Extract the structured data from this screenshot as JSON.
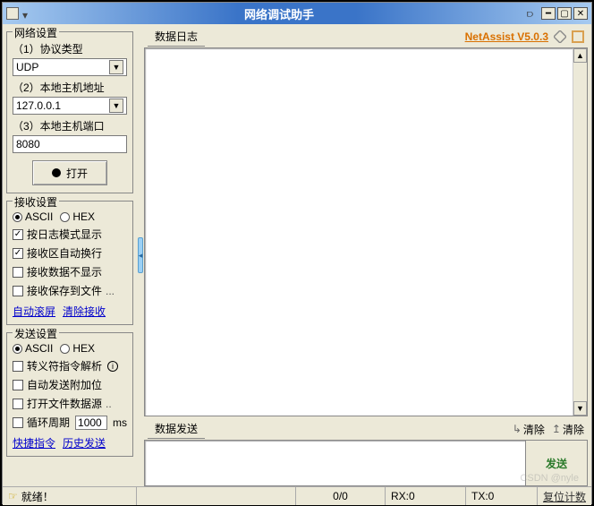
{
  "title": "网络调试助手",
  "brand": "NetAssist V5.0.3",
  "network_group": {
    "title": "网络设置",
    "proto_label": "（1）协议类型",
    "proto_value": "UDP",
    "host_label": "（2）本地主机地址",
    "host_value": "127.0.0.1",
    "port_label": "（3）本地主机端口",
    "port_value": "8080",
    "open_button": "打开"
  },
  "recv_group": {
    "title": "接收设置",
    "ascii": "ASCII",
    "hex": "HEX",
    "log_mode": "按日志模式显示",
    "auto_wrap": "接收区自动换行",
    "hide_recv": "接收数据不显示",
    "save_file": "接收保存到文件",
    "auto_scroll": "自动滚屏",
    "clear_recv": "清除接收"
  },
  "send_group": {
    "title": "发送设置",
    "ascii": "ASCII",
    "hex": "HEX",
    "escape": "转义符指令解析",
    "auto_append": "自动发送附加位",
    "open_file": "打开文件数据源",
    "cycle": "循环周期",
    "cycle_value": "1000",
    "cycle_unit": "ms",
    "quick_cmd": "快捷指令",
    "history": "历史发送"
  },
  "log_header": "数据日志",
  "send_header": "数据发送",
  "clear1": "清除",
  "clear2": "清除",
  "send_button": "发送",
  "status": {
    "ready": "就绪！",
    "counter": "0/0",
    "rx": "RX:0",
    "tx": "TX:0",
    "reset": "复位计数"
  },
  "watermark": "CSDN @nyle"
}
